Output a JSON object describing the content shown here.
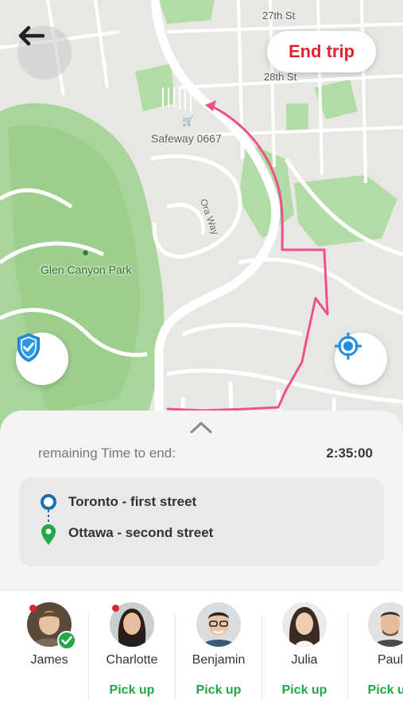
{
  "map": {
    "street_27": "27th St",
    "street_28": "28th St",
    "poi_store": "Safeway 0667",
    "street_ora": "Ora Way",
    "park": "Glen Canyon Park"
  },
  "header": {
    "back_icon": "arrow-left-icon",
    "end_trip_label": "End trip"
  },
  "controls": {
    "safety_icon": "shield-check-icon",
    "locate_icon": "crosshair-icon"
  },
  "trip": {
    "remaining_label": "remaining Time to end:",
    "remaining_value": "2:35:00",
    "from": "Toronto - first street",
    "to": "Ottawa - second street"
  },
  "riders": [
    {
      "name": "James",
      "status": "picked-up",
      "online": true,
      "action": ""
    },
    {
      "name": "Charlotte",
      "status": "waiting",
      "online": true,
      "action": "Pick up"
    },
    {
      "name": "Benjamin",
      "status": "waiting",
      "online": false,
      "action": "Pick up"
    },
    {
      "name": "Julia",
      "status": "waiting",
      "online": false,
      "action": "Pick up"
    },
    {
      "name": "Paul",
      "status": "waiting",
      "online": false,
      "action": "Pick up"
    }
  ],
  "colors": {
    "accent_red": "#e0232e",
    "route_pink": "#f0508a",
    "success_green": "#21a847",
    "info_blue": "#1d8fe0"
  }
}
